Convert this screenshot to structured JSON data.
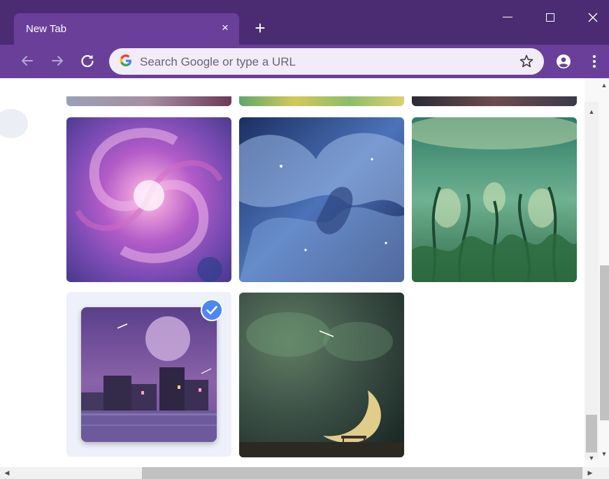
{
  "tab": {
    "title": "New Tab",
    "close_glyph": "×",
    "new_tab_glyph": "+"
  },
  "window_controls": {
    "minimize": "minimize-icon",
    "maximize": "maximize-icon",
    "close": "close-icon"
  },
  "toolbar": {
    "back_icon": "back-arrow-icon",
    "forward_icon": "forward-arrow-icon",
    "reload_icon": "reload-icon",
    "google_logo": "G",
    "omnibox_placeholder": "Search Google or type a URL",
    "bookmark_icon": "star-icon",
    "profile_icon": "profile-icon",
    "menu_icon": "kebab-menu-icon"
  },
  "theme_colors": {
    "frame": "#4b2c72",
    "toolbar": "#6a3f99",
    "omnibox": "#f1ecf7",
    "selected_check": "#4d88f0"
  },
  "backgrounds": [
    {
      "name": "purple galaxy",
      "selected": false
    },
    {
      "name": "blue nebula",
      "selected": false
    },
    {
      "name": "green abstract",
      "selected": false
    },
    {
      "name": "purple night city",
      "selected": true
    },
    {
      "name": "crescent moon",
      "selected": false
    }
  ]
}
